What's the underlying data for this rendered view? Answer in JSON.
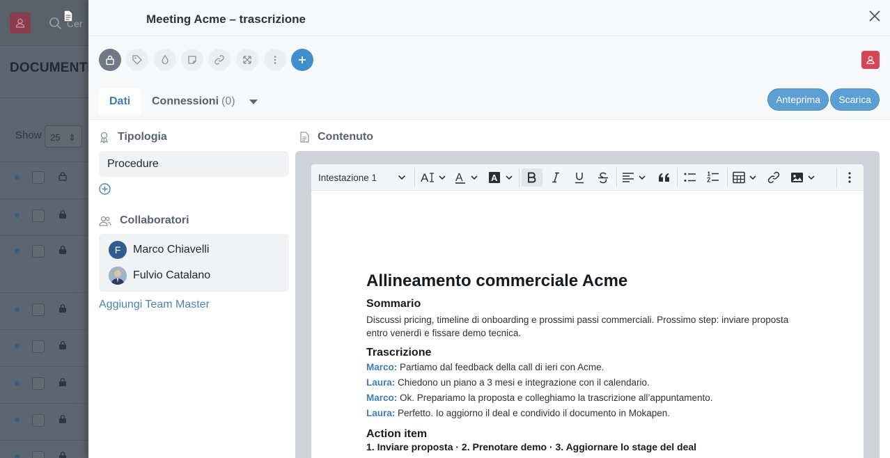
{
  "background": {
    "search_placeholder": "Cer",
    "title": "DOCUMENTI",
    "show_label": "Show",
    "page_size": "25"
  },
  "panel": {
    "title": "Meeting Acme – trascrizione",
    "toolbar_icons": [
      "lock-icon",
      "tag-icon",
      "drop-icon",
      "note-icon",
      "link-icon",
      "expand-icon",
      "more-icon",
      "add-icon"
    ],
    "tabs": {
      "dati": "Dati",
      "connessioni": "Connessioni",
      "connessioni_count": "(0)"
    },
    "buttons": {
      "anteprima": "Anteprima",
      "scarica": "Scarica"
    }
  },
  "left": {
    "tipologia_label": "Tipologia",
    "tipologia_value": "Procedure",
    "collaboratori_label": "Collaboratori",
    "collaborators": [
      {
        "name": "Marco Chiavelli",
        "initial": "F"
      },
      {
        "name": "Fulvio Catalano",
        "initial": ""
      }
    ],
    "add_team": "Aggiungi Team Master"
  },
  "editor": {
    "section_label": "Contenuto",
    "heading_select": "Intestazione 1",
    "doc": {
      "title": "Allineamento commerciale Acme",
      "summary_heading": "Sommario",
      "summary_text": "Discussi pricing, timeline di onboarding e prossimi passi commerciali. Prossimo step: inviare proposta entro venerdì e fissare demo tecnica.",
      "transcript_heading": "Trascrizione",
      "transcript": [
        {
          "speaker": "Marco:",
          "text": " Partiamo dal feedback della call di ieri con Acme."
        },
        {
          "speaker": "Laura:",
          "text": " Chiedono un piano a 3 mesi e integrazione con il calendario."
        },
        {
          "speaker": "Marco:",
          "text": " Ok. Prepariamo la proposta e colleghiamo la trascrizione all’appuntamento."
        },
        {
          "speaker": "Laura:",
          "text": " Perfetto. Io aggiorno il deal e condivido il documento in Mokapen."
        }
      ],
      "action_heading": "Action item",
      "action_text": "1. Inviare proposta · 2. Prenotare demo · 3. Aggiornare lo stage del deal"
    }
  }
}
